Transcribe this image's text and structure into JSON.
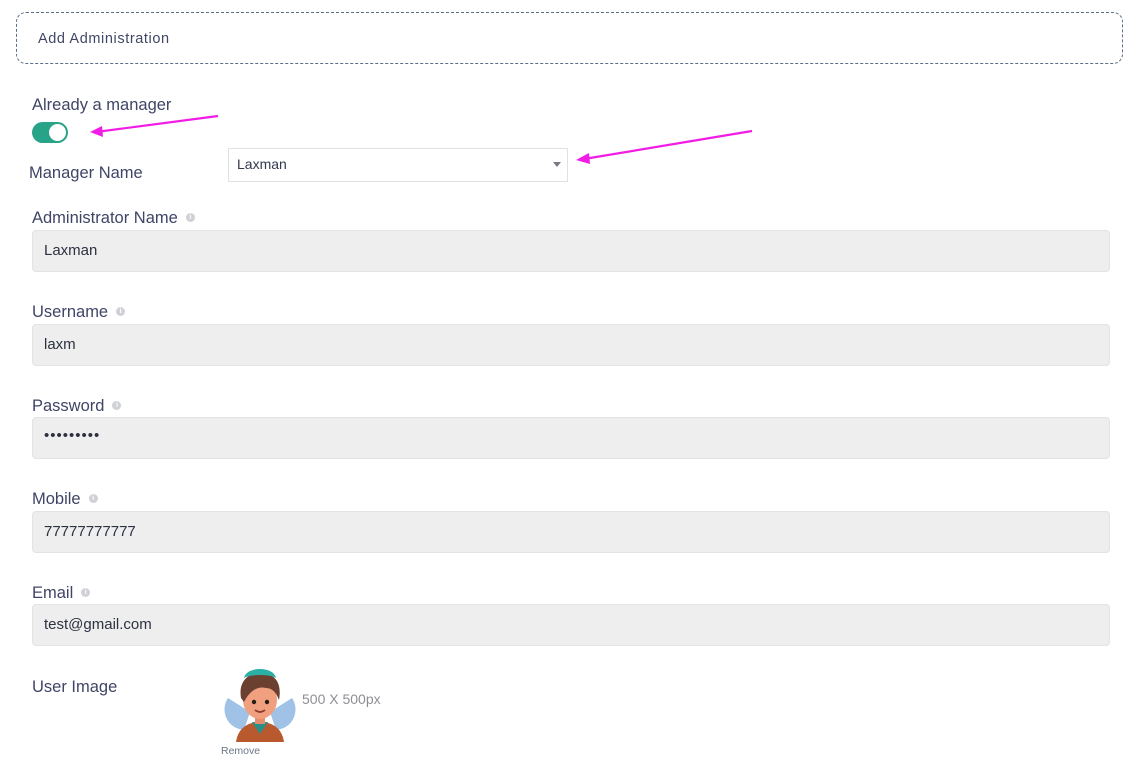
{
  "header": {
    "title": "Add Administration"
  },
  "manager": {
    "toggle_label": "Already a manager",
    "toggle_on": true,
    "name_label": "Manager Name",
    "selected": "Laxman"
  },
  "fields": {
    "admin_name": {
      "label": "Administrator Name",
      "value": "Laxman"
    },
    "username": {
      "label": "Username",
      "value": "laxm"
    },
    "password": {
      "label": "Password",
      "value": "•••••••••"
    },
    "mobile": {
      "label": "Mobile",
      "value": "77777777777"
    },
    "email": {
      "label": "Email",
      "value": "test@gmail.com"
    }
  },
  "user_image": {
    "label": "User Image",
    "size_hint": "500 X 500px",
    "remove_label": "Remove"
  },
  "colors": {
    "toggle_on": "#27a387",
    "annotation_arrow": "#f21ce6",
    "field_bg": "#eeeeee"
  },
  "icons": {
    "info": "info-icon",
    "caret": "chevron-down-icon",
    "avatar": "avatar"
  }
}
